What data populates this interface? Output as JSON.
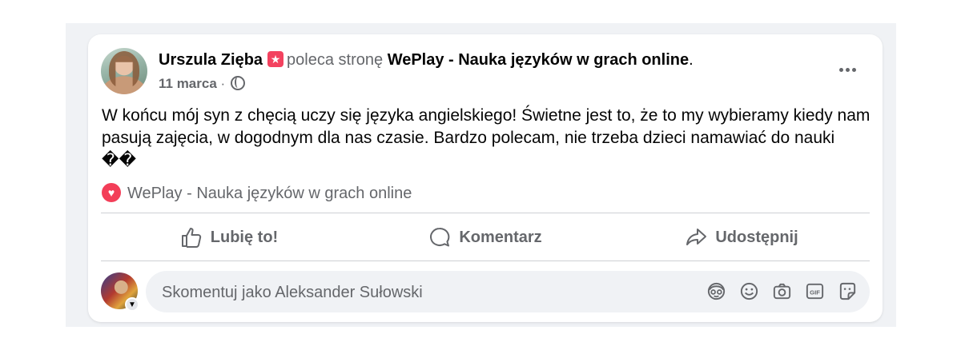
{
  "post": {
    "author": "Urszula Zięba",
    "recommends_text": "poleca stronę",
    "page_name": "WePlay - Nauka języków w grach online",
    "period": ".",
    "date": "11 marca",
    "date_separator": "·",
    "body": "W końcu mój syn z chęcią uczy się języka angielskiego! Świetne jest to, że to my wybieramy kiedy nam pasują zajęcia, w dogodnym dla nas czasie. Bardzo polecam, nie trzeba dzieci namawiać do nauki ��",
    "recommendation_page": "WePlay - Nauka języków w grach online"
  },
  "actions": {
    "like": "Lubię to!",
    "comment": "Komentarz",
    "share": "Udostępnij"
  },
  "comment": {
    "placeholder": "Skomentuj jako Aleksander Sułowski"
  },
  "icons": {
    "badge": "star-badge-icon",
    "privacy": "globe-icon",
    "more": "more-options-icon",
    "recommend": "heart-icon",
    "comment_tools": [
      "avatar-sticker-icon",
      "emoji-icon",
      "camera-icon",
      "gif-icon",
      "sticker-icon"
    ]
  },
  "colors": {
    "badge": "#f3425f",
    "heart": "#f33e58",
    "muted": "#65676b",
    "divider": "#ced0d4",
    "comment_bg": "#f0f2f5"
  }
}
